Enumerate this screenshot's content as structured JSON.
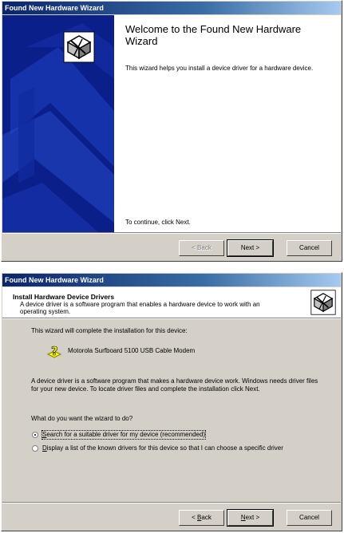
{
  "welcome_window": {
    "title": "Found New Hardware Wizard",
    "heading": "Welcome to the Found New Hardware Wizard",
    "description": "This wizard helps you install a device driver for a hardware device.",
    "continue_text": "To continue, click Next.",
    "buttons": {
      "back": "< Back",
      "next": "Next >",
      "cancel": "Cancel"
    },
    "icon": "hardware-wizard-icon"
  },
  "install_window": {
    "title": "Found New Hardware Wizard",
    "header_title": "Install Hardware Device Drivers",
    "header_subtitle": "A device driver is a software program that enables a hardware device to work with an operating system.",
    "complete_text": "This wizard will complete the installation for this device:",
    "device_name": "Motorola Surfboard 5100 USB Cable Modem",
    "driver_info": "A device driver is a software program that makes a hardware device work. Windows needs driver files for your new device. To locate driver files and complete the installation click Next.",
    "question": "What do you want the wizard to do?",
    "options": [
      {
        "pre": "",
        "key": "S",
        "rest": "earch for a suitable driver for my device (recommended)",
        "checked": true
      },
      {
        "pre": "",
        "key": "D",
        "rest": "isplay a list of the known drivers for this device so that I can choose a specific driver",
        "checked": false
      }
    ],
    "buttons": {
      "back_pre": "< ",
      "back_key": "B",
      "back_rest": "ack",
      "next_key": "N",
      "next_rest": "ext >",
      "cancel": "Cancel"
    },
    "icons": [
      "hardware-wizard-icon",
      "question-device-icon"
    ]
  },
  "colors": {
    "titlebar": "#0a246a",
    "banner": "#0b1f8a",
    "face": "#d4d0c8"
  }
}
